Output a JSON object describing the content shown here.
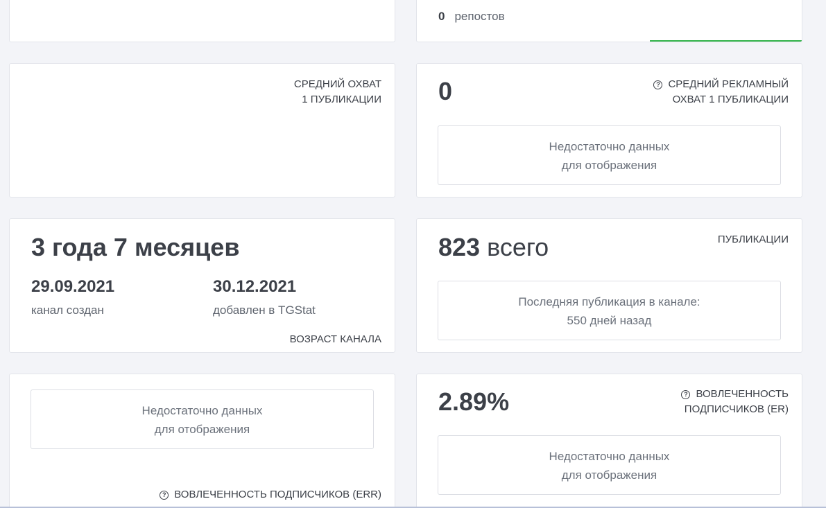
{
  "top_right": {
    "reposts_count": "0",
    "reposts_label": "репостов"
  },
  "avg_reach": {
    "label_line1": "СРЕДНИЙ ОХВАТ",
    "label_line2": "1 ПУБЛИКАЦИИ"
  },
  "avg_ad_reach": {
    "value": "0",
    "label_line1": "СРЕДНИЙ РЕКЛАМНЫЙ",
    "label_line2": "ОХВАТ 1 ПУБЛИКАЦИИ",
    "nodata_line1": "Недостаточно данных",
    "nodata_line2": "для отображения"
  },
  "channel_age": {
    "value": "3 года 7 месяцев",
    "created_date": "29.09.2021",
    "created_caption": "канал создан",
    "added_date": "30.12.2021",
    "added_caption": "добавлен в TGStat",
    "label": "ВОЗРАСТ КАНАЛА"
  },
  "publications": {
    "count": "823",
    "count_unit": "всего",
    "label": "ПУБЛИКАЦИИ",
    "last_line1": "Последняя публикация в канале:",
    "last_line2": "550 дней назад"
  },
  "err": {
    "nodata_line1": "Недостаточно данных",
    "nodata_line2": "для отображения",
    "label": "ВОВЛЕЧЕННОСТЬ ПОДПИСЧИКОВ (ERR)"
  },
  "er": {
    "value": "2.89%",
    "label_line1": "ВОВЛЕЧЕННОСТЬ",
    "label_line2": "ПОДПИСЧИКОВ (ER)",
    "nodata_line1": "Недостаточно данных",
    "nodata_line2": "для отображения"
  }
}
